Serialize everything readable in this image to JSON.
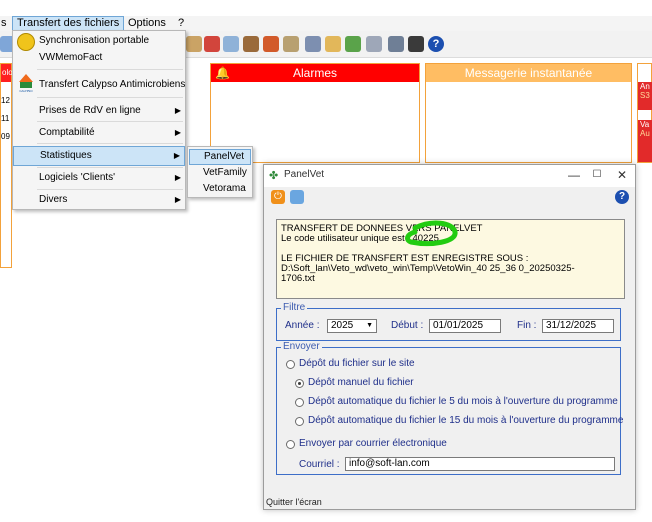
{
  "menubar": {
    "items": [
      "s",
      "Transfert des fichiers",
      "Options",
      "?"
    ]
  },
  "dropdown": {
    "items": [
      {
        "label": "Synchronisation portable",
        "icon": "sync-icon",
        "submenu": false
      },
      {
        "label": "VWMemoFact",
        "icon": "",
        "submenu": false
      },
      {
        "label": "Transfert Calypso Antimicrobiens",
        "icon": "calypso-logo",
        "submenu": false
      },
      {
        "label": "Prises de RdV en ligne",
        "icon": "",
        "submenu": true
      },
      {
        "label": "Comptabilité",
        "icon": "",
        "submenu": true
      },
      {
        "label": "Statistiques",
        "icon": "",
        "submenu": true
      },
      {
        "label": "Logiciels 'Clients'",
        "icon": "",
        "submenu": true
      },
      {
        "label": "Divers",
        "icon": "",
        "submenu": true
      }
    ]
  },
  "submenu": {
    "items": [
      "PanelVet",
      "VetFamily",
      "Vetorama"
    ]
  },
  "panels": {
    "alarmes": "Alarmes",
    "messagerie": "Messagerie instantanée",
    "left_fragments": [
      "olo",
      "12",
      "11",
      "09"
    ],
    "right_fragments": [
      "An",
      "S3",
      "Va",
      "Au"
    ]
  },
  "window": {
    "title": "PanelVet",
    "info_lines": [
      "TRANSFERT DE DONNEES VERS PANELVET",
      "Le code utilisateur unique est : 40225",
      "",
      "LE FICHIER DE TRANSFERT EST ENREGISTRE SOUS :",
      "D:\\Soft_lan\\Veto_wd\\veto_win\\Temp\\VetoWin_40  25_36   0_20250325-",
      "1706.txt"
    ],
    "filtre": {
      "legend": "Filtre",
      "annee_label": "Année :",
      "annee_value": "2025",
      "debut_label": "Début :",
      "debut_value": "01/01/2025",
      "fin_label": "Fin :",
      "fin_value": "31/12/2025"
    },
    "envoyer": {
      "legend": "Envoyer",
      "depot_site": "Dépôt du fichier sur le site",
      "depot_manuel": "Dépôt manuel du fichier",
      "depot_auto_5": "Dépôt automatique du fichier le 5 du mois à l'ouverture du programme",
      "depot_auto_15": "Dépôt automatique du fichier le 15 du mois à l'ouverture du programme",
      "courrier": "Envoyer par courrier électronique",
      "courriel_label": "Courriel :",
      "courriel_value": "info@soft-lan.com"
    },
    "status": "Quitter l'écran"
  },
  "colors": {
    "alarm_red": "#ff0000",
    "msg_orange": "#ffbd63",
    "highlight": "#cce4f7",
    "fieldset_blue": "#3d6ec8",
    "marker_green": "#22cc11"
  }
}
